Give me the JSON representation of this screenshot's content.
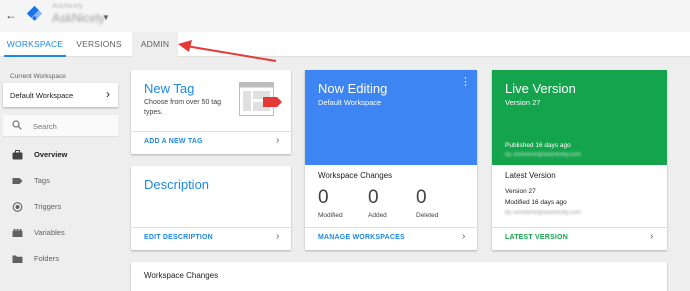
{
  "header": {
    "back_icon": "arrow-back-icon",
    "logo_icon": "gtm-logo-icon",
    "account_label": "AskNicely",
    "container_name": "AskNicely"
  },
  "tabs": [
    {
      "label": "WORKSPACE",
      "active": true
    },
    {
      "label": "VERSIONS",
      "active": false
    },
    {
      "label": "ADMIN",
      "active": false
    }
  ],
  "sidebar": {
    "current_workspace_label": "Current Workspace",
    "workspace_name": "Default Workspace",
    "search_placeholder": "Search",
    "items": [
      {
        "label": "Overview",
        "icon": "briefcase-icon",
        "active": true
      },
      {
        "label": "Tags",
        "icon": "tag-icon",
        "active": false
      },
      {
        "label": "Triggers",
        "icon": "trigger-icon",
        "active": false
      },
      {
        "label": "Variables",
        "icon": "variables-icon",
        "active": false
      },
      {
        "label": "Folders",
        "icon": "folder-icon",
        "active": false
      }
    ]
  },
  "new_tag": {
    "title": "New Tag",
    "description": "Choose from over 50 tag types.",
    "link": "ADD A NEW TAG"
  },
  "description_card": {
    "title": "Description",
    "link": "EDIT DESCRIPTION"
  },
  "now_editing": {
    "title": "Now Editing",
    "subtitle": "Default Workspace",
    "changes_title": "Workspace Changes",
    "stats": [
      {
        "value": "0",
        "label": "Modified"
      },
      {
        "value": "0",
        "label": "Added"
      },
      {
        "value": "0",
        "label": "Deleted"
      }
    ],
    "link": "MANAGE WORKSPACES"
  },
  "live_version": {
    "title": "Live Version",
    "subtitle": "Version 27",
    "published": "Published 16 days ago",
    "published_by": "by someone@asknicely.com",
    "latest_title": "Latest Version",
    "latest_version": "Version 27",
    "modified": "Modified 16 days ago",
    "modified_by": "by someone@asknicely.com",
    "link": "LATEST VERSION"
  },
  "workspace_changes_section": {
    "title": "Workspace Changes"
  },
  "colors": {
    "accent_blue": "#1e88e5",
    "editing_blue": "#3d85f2",
    "live_green": "#14a44d",
    "annotation_red": "#e53935"
  }
}
